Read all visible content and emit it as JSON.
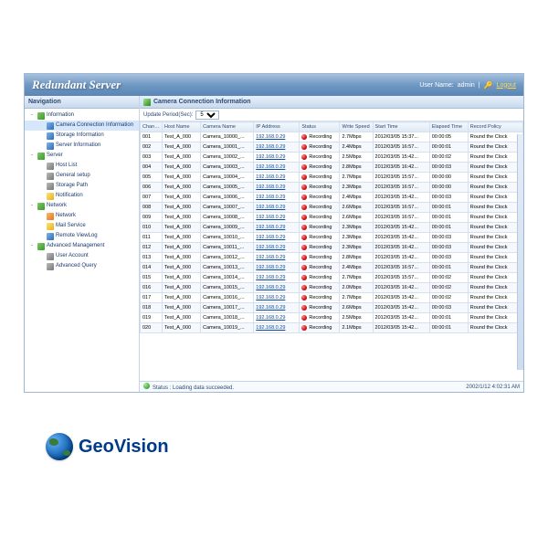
{
  "titlebar": {
    "title": "Redundant Server",
    "user_label": "User Name:",
    "user_value": "admin",
    "logout": "Logout"
  },
  "nav": {
    "header": "Navigation",
    "tree": [
      {
        "lbl": "Information",
        "ind": 0,
        "tw": "-",
        "ic": "ic-g",
        "children": [
          {
            "lbl": "Camera Connection Information",
            "ind": 1,
            "ic": "ic-b",
            "sel": true
          },
          {
            "lbl": "Storage Information",
            "ind": 1,
            "ic": "ic-b"
          },
          {
            "lbl": "Server Information",
            "ind": 1,
            "ic": "ic-b"
          }
        ]
      },
      {
        "lbl": "Server",
        "ind": 0,
        "tw": "-",
        "ic": "ic-g",
        "children": [
          {
            "lbl": "Host List",
            "ind": 1,
            "ic": "ic-gr"
          },
          {
            "lbl": "General setup",
            "ind": 1,
            "ic": "ic-gr"
          },
          {
            "lbl": "Storage Path",
            "ind": 1,
            "ic": "ic-gr"
          },
          {
            "lbl": "Notification",
            "ind": 1,
            "ic": "ic-y"
          }
        ]
      },
      {
        "lbl": "Network",
        "ind": 0,
        "tw": "-",
        "ic": "ic-g",
        "children": [
          {
            "lbl": "Network",
            "ind": 1,
            "ic": "ic-o"
          },
          {
            "lbl": "Mail Service",
            "ind": 1,
            "ic": "ic-y"
          },
          {
            "lbl": "Remote ViewLog",
            "ind": 1,
            "ic": "ic-b"
          }
        ]
      },
      {
        "lbl": "Advanced Management",
        "ind": 0,
        "tw": "-",
        "ic": "ic-g",
        "children": [
          {
            "lbl": "User Account",
            "ind": 1,
            "ic": "ic-gr"
          },
          {
            "lbl": "Advanced Query",
            "ind": 1,
            "ic": "ic-gr"
          }
        ]
      }
    ]
  },
  "main": {
    "header": "Camera Connection Information",
    "period_label": "Update Period(Sec):",
    "period_value": "5",
    "columns": [
      "Channel",
      "Host Name",
      "Camera Name",
      "IP Address",
      "Status",
      "Write Speed",
      "Start Time",
      "Elapsed Time",
      "Record Policy"
    ],
    "rows": [
      {
        "ch": "001",
        "hn": "Test_A_000",
        "cn": "Camera_10000_...",
        "ip": "192.168.0.29",
        "st": "Recording",
        "ws": "2.7Mbps",
        "sta": "2012/03/05 15:37...",
        "et": "00:00:05",
        "rp": "Round the Clock"
      },
      {
        "ch": "002",
        "hn": "Test_A_000",
        "cn": "Camera_10001_...",
        "ip": "192.168.0.29",
        "st": "Recording",
        "ws": "2.4Mbps",
        "sta": "2012/03/05 16:57...",
        "et": "00:00:01",
        "rp": "Round the Clock"
      },
      {
        "ch": "003",
        "hn": "Test_A_000",
        "cn": "Camera_10002_...",
        "ip": "192.168.0.29",
        "st": "Recording",
        "ws": "2.5Mbps",
        "sta": "2012/03/05 15:42...",
        "et": "00:00:02",
        "rp": "Round the Clock"
      },
      {
        "ch": "004",
        "hn": "Test_A_000",
        "cn": "Camera_10003_...",
        "ip": "192.168.0.29",
        "st": "Recording",
        "ws": "2.8Mbps",
        "sta": "2012/03/05 16:42...",
        "et": "00:00:03",
        "rp": "Round the Clock"
      },
      {
        "ch": "005",
        "hn": "Test_A_000",
        "cn": "Camera_10004_...",
        "ip": "192.168.0.29",
        "st": "Recording",
        "ws": "2.7Mbps",
        "sta": "2012/03/05 15:57...",
        "et": "00:00:00",
        "rp": "Round the Clock"
      },
      {
        "ch": "006",
        "hn": "Test_A_000",
        "cn": "Camera_10005_...",
        "ip": "192.168.0.29",
        "st": "Recording",
        "ws": "2.3Mbps",
        "sta": "2012/03/05 16:57...",
        "et": "00:00:00",
        "rp": "Round the Clock"
      },
      {
        "ch": "007",
        "hn": "Test_A_000",
        "cn": "Camera_10006_...",
        "ip": "192.168.0.29",
        "st": "Recording",
        "ws": "2.4Mbps",
        "sta": "2012/03/05 15:42...",
        "et": "00:00:03",
        "rp": "Round the Clock"
      },
      {
        "ch": "008",
        "hn": "Test_A_000",
        "cn": "Camera_10007_...",
        "ip": "192.168.0.29",
        "st": "Recording",
        "ws": "2.6Mbps",
        "sta": "2012/03/05 16:57...",
        "et": "00:00:01",
        "rp": "Round the Clock"
      },
      {
        "ch": "009",
        "hn": "Test_A_000",
        "cn": "Camera_10008_...",
        "ip": "192.168.0.29",
        "st": "Recording",
        "ws": "2.6Mbps",
        "sta": "2012/03/05 16:57...",
        "et": "00:00:01",
        "rp": "Round the Clock"
      },
      {
        "ch": "010",
        "hn": "Test_A_000",
        "cn": "Camera_10009_...",
        "ip": "192.168.0.29",
        "st": "Recording",
        "ws": "2.3Mbps",
        "sta": "2012/03/05 15:42...",
        "et": "00:00:01",
        "rp": "Round the Clock"
      },
      {
        "ch": "011",
        "hn": "Test_A_000",
        "cn": "Camera_10010_...",
        "ip": "192.168.0.29",
        "st": "Recording",
        "ws": "2.3Mbps",
        "sta": "2012/03/05 15:42...",
        "et": "00:00:03",
        "rp": "Round the Clock"
      },
      {
        "ch": "012",
        "hn": "Test_A_000",
        "cn": "Camera_10011_...",
        "ip": "192.168.0.29",
        "st": "Recording",
        "ws": "2.3Mbps",
        "sta": "2012/03/05 16:42...",
        "et": "00:00:03",
        "rp": "Round the Clock"
      },
      {
        "ch": "013",
        "hn": "Test_A_000",
        "cn": "Camera_10012_...",
        "ip": "192.168.0.29",
        "st": "Recording",
        "ws": "2.8Mbps",
        "sta": "2012/03/05 15:42...",
        "et": "00:00:03",
        "rp": "Round the Clock"
      },
      {
        "ch": "014",
        "hn": "Test_A_000",
        "cn": "Camera_10013_...",
        "ip": "192.168.0.29",
        "st": "Recording",
        "ws": "2.4Mbps",
        "sta": "2012/03/05 16:57...",
        "et": "00:00:01",
        "rp": "Round the Clock"
      },
      {
        "ch": "015",
        "hn": "Test_A_000",
        "cn": "Camera_10014_...",
        "ip": "192.168.0.29",
        "st": "Recording",
        "ws": "2.7Mbps",
        "sta": "2012/03/05 15:57...",
        "et": "00:00:02",
        "rp": "Round the Clock"
      },
      {
        "ch": "016",
        "hn": "Test_A_000",
        "cn": "Camera_10015_...",
        "ip": "192.168.0.29",
        "st": "Recording",
        "ws": "2.0Mbps",
        "sta": "2012/03/05 16:42...",
        "et": "00:00:02",
        "rp": "Round the Clock"
      },
      {
        "ch": "017",
        "hn": "Test_A_000",
        "cn": "Camera_10016_...",
        "ip": "192.168.0.29",
        "st": "Recording",
        "ws": "2.7Mbps",
        "sta": "2012/03/05 15:42...",
        "et": "00:00:02",
        "rp": "Round the Clock"
      },
      {
        "ch": "018",
        "hn": "Test_A_000",
        "cn": "Camera_10017_...",
        "ip": "192.168.0.29",
        "st": "Recording",
        "ws": "2.6Mbps",
        "sta": "2012/03/05 15:42...",
        "et": "00:00:03",
        "rp": "Round the Clock"
      },
      {
        "ch": "019",
        "hn": "Test_A_000",
        "cn": "Camera_10018_...",
        "ip": "192.168.0.29",
        "st": "Recording",
        "ws": "2.5Mbps",
        "sta": "2012/03/05 15:42...",
        "et": "00:00:01",
        "rp": "Round the Clock"
      },
      {
        "ch": "020",
        "hn": "Test_A_000",
        "cn": "Camera_10019_...",
        "ip": "192.168.0.29",
        "st": "Recording",
        "ws": "2.1Mbps",
        "sta": "2012/03/05 15:42...",
        "et": "00:00:01",
        "rp": "Round the Clock"
      }
    ],
    "status_text": "Status : Loading data succeeded.",
    "status_time": "2002/1/12 4:02:31 AM"
  },
  "logo": {
    "text": "GeoVision"
  }
}
